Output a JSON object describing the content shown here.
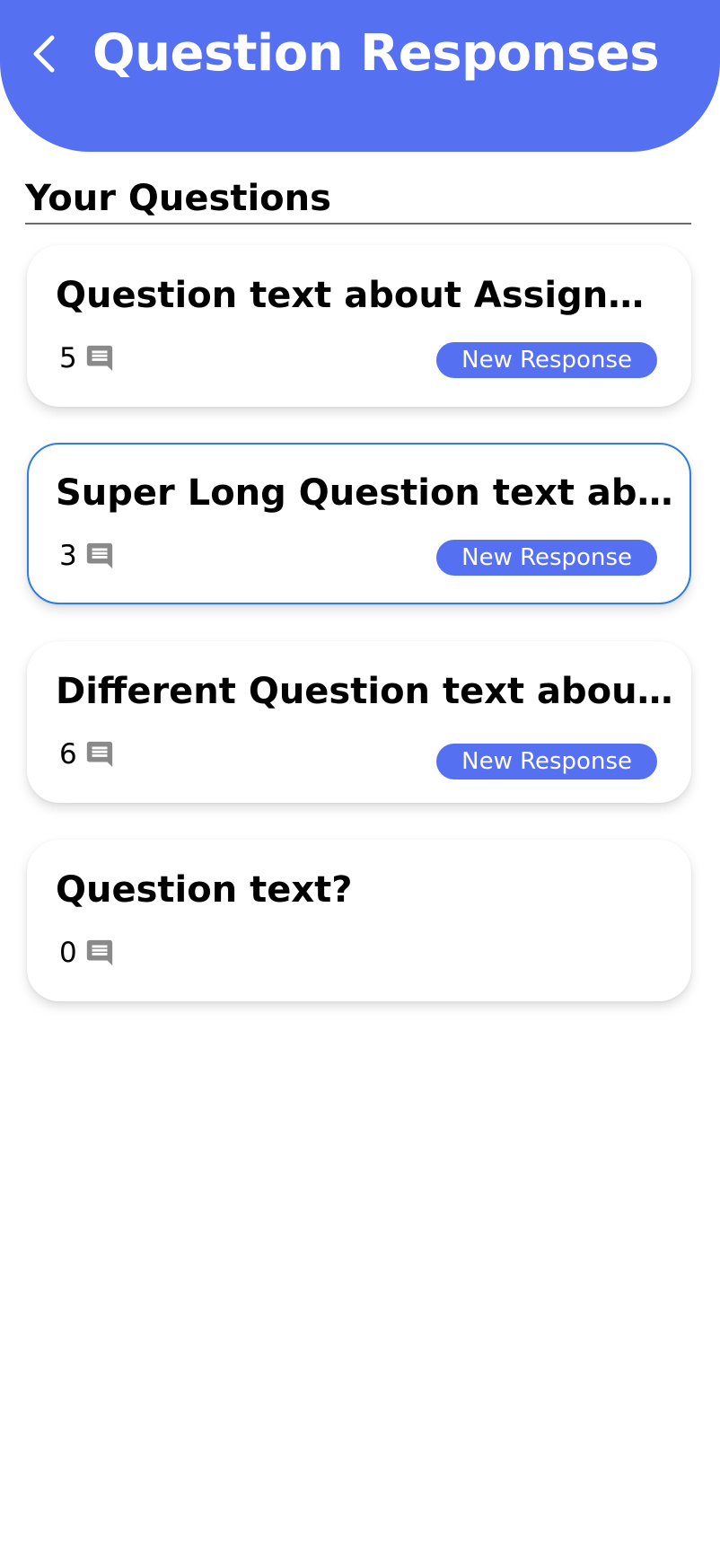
{
  "header": {
    "title": "Question Responses",
    "back_icon": "chevron-left-icon",
    "background_color": "#5670f2"
  },
  "section": {
    "title": "Your Questions"
  },
  "questions": [
    {
      "title": "Question text about Assignm...",
      "response_count": "5",
      "badge": "New Response",
      "selected": false
    },
    {
      "title": "Super Long Question text ab...",
      "response_count": "3",
      "badge": "New Response",
      "selected": true
    },
    {
      "title": "Different Question text about...",
      "response_count": "6",
      "badge": "New Response",
      "selected": false
    },
    {
      "title": "Question text?",
      "response_count": "0",
      "badge": "",
      "selected": false
    }
  ],
  "icons": {
    "comment": "comment-icon"
  },
  "colors": {
    "accent": "#5670f2",
    "selected_border": "#2f7de1",
    "icon_gray": "#8a8a8a"
  }
}
